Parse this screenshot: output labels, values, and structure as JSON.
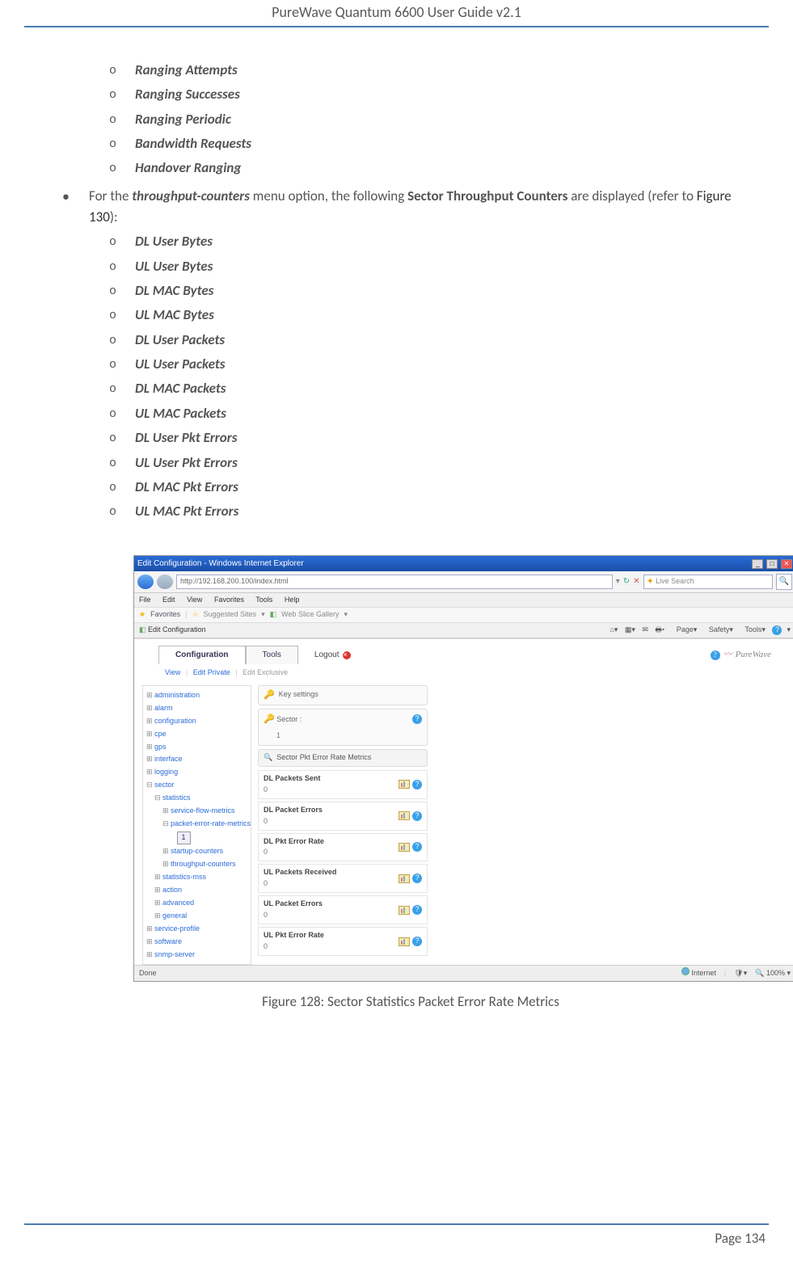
{
  "header": {
    "title": "PureWave Quantum 6600 User Guide v2.1"
  },
  "list1": [
    "Ranging Attempts",
    "Ranging Successes",
    "Ranging Periodic",
    "Bandwidth Requests",
    "Handover Ranging"
  ],
  "para": {
    "pre": "For the ",
    "term": "throughput-counters",
    "mid": " menu option, the following ",
    "term2": "Sector Throughput Counters",
    "post": " are displayed (refer to ",
    "figref": "Figure 130",
    "end": "):"
  },
  "list2": [
    "DL User Bytes",
    "UL User Bytes",
    "DL MAC Bytes",
    "UL MAC Bytes",
    "DL User Packets",
    "UL User Packets",
    "DL MAC Packets",
    "UL MAC Packets",
    "DL User Pkt Errors",
    "UL User Pkt Errors",
    "DL MAC Pkt Errors",
    "UL MAC Pkt Errors"
  ],
  "screenshot": {
    "wintitle": "Edit Configuration - Windows Internet Explorer",
    "url": "http://192.168.200.100/index.html",
    "searchPlaceholder": "Live Search",
    "menus": [
      "File",
      "Edit",
      "View",
      "Favorites",
      "Tools",
      "Help"
    ],
    "favLabel": "Favorites",
    "favLinks": [
      "Suggested Sites",
      "Web Slice Gallery"
    ],
    "tabLabel": "Edit Configuration",
    "toolbarItems": [
      "Page",
      "Safety",
      "Tools"
    ],
    "apptabs": {
      "conf": "Configuration",
      "tools": "Tools"
    },
    "logout": "Logout",
    "brand": "PureWave",
    "subtabs": [
      "View",
      "Edit Private",
      "Edit Exclusive"
    ],
    "tree": [
      {
        "lvl": 0,
        "t": "exp",
        "txt": "administration"
      },
      {
        "lvl": 0,
        "t": "exp",
        "txt": "alarm"
      },
      {
        "lvl": 0,
        "t": "exp",
        "txt": "configuration"
      },
      {
        "lvl": 0,
        "t": "exp",
        "txt": "cpe"
      },
      {
        "lvl": 0,
        "t": "exp",
        "txt": "gps"
      },
      {
        "lvl": 0,
        "t": "exp",
        "txt": "interface"
      },
      {
        "lvl": 0,
        "t": "exp",
        "txt": "logging"
      },
      {
        "lvl": 0,
        "t": "col",
        "txt": "sector"
      },
      {
        "lvl": 1,
        "t": "col",
        "txt": "statistics"
      },
      {
        "lvl": 2,
        "t": "exp",
        "txt": "service-flow-metrics"
      },
      {
        "lvl": 2,
        "t": "col",
        "txt": "packet-error-rate-metrics"
      },
      {
        "lvl": 3,
        "t": "sel",
        "txt": "1"
      },
      {
        "lvl": 2,
        "t": "exp",
        "txt": "startup-counters"
      },
      {
        "lvl": 2,
        "t": "exp",
        "txt": "throughput-counters"
      },
      {
        "lvl": 1,
        "t": "exp",
        "txt": "statistics-mss"
      },
      {
        "lvl": 1,
        "t": "exp",
        "txt": "action"
      },
      {
        "lvl": 1,
        "t": "exp",
        "txt": "advanced"
      },
      {
        "lvl": 1,
        "t": "exp",
        "txt": "general"
      },
      {
        "lvl": 0,
        "t": "exp",
        "txt": "service-profile"
      },
      {
        "lvl": 0,
        "t": "exp",
        "txt": "software"
      },
      {
        "lvl": 0,
        "t": "exp",
        "txt": "snmp-server"
      }
    ],
    "panel": {
      "keySettings": "Key settings",
      "sectorLabel": "Sector :",
      "sectorVal": "1",
      "sectionTitle": "Sector Pkt Error Rate Metrics",
      "metrics": [
        {
          "label": "DL Packets Sent",
          "val": "0"
        },
        {
          "label": "DL Packet Errors",
          "val": "0"
        },
        {
          "label": "DL Pkt Error Rate",
          "val": "0"
        },
        {
          "label": "UL Packets Received",
          "val": "0"
        },
        {
          "label": "UL Packet Errors",
          "val": "0"
        },
        {
          "label": "UL Pkt Error Rate",
          "val": "0"
        }
      ]
    },
    "status": {
      "done": "Done",
      "zone": "Internet",
      "zoom": "100%"
    }
  },
  "figcaption": "Figure 128: Sector Statistics Packet Error Rate Metrics",
  "footer": "Page 134"
}
